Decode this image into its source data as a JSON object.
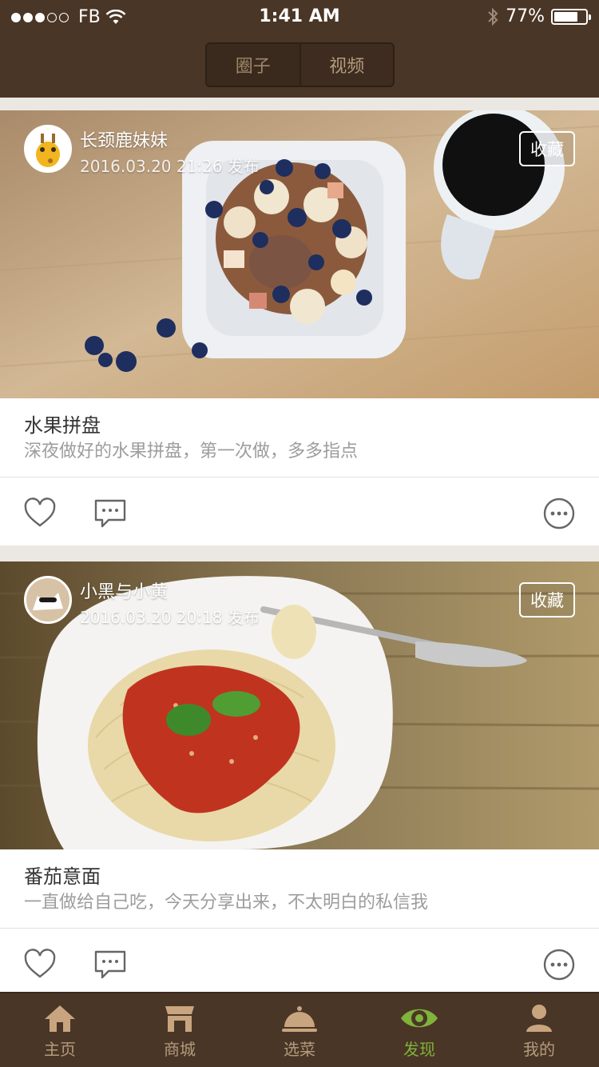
{
  "status_bar": {
    "carrier": "FB",
    "time": "1:41 AM",
    "battery_text": "77%",
    "battery_level": 0.77,
    "signal_bars_filled": 3,
    "signal_bars_total": 5
  },
  "segmented": {
    "tabs": [
      {
        "label": "圈子",
        "active": true
      },
      {
        "label": "视频",
        "active": false
      }
    ]
  },
  "posts": [
    {
      "author": "长颈鹿妹妹",
      "time": "2016.03.20 21:26 发布",
      "collect_label": "收藏",
      "title": "水果拼盘",
      "description": "深夜做好的水果拼盘，第一次做，多多指点"
    },
    {
      "author": "小黑与小黄",
      "time": "2016.03.20 20:18 发布",
      "collect_label": "收藏",
      "title": "番茄意面",
      "description": "一直做给自己吃，今天分享出来，不太明白的私信我"
    }
  ],
  "tabbar": {
    "items": [
      {
        "label": "主页",
        "icon": "home-icon",
        "active": false
      },
      {
        "label": "商城",
        "icon": "shop-icon",
        "active": false
      },
      {
        "label": "选菜",
        "icon": "cloche-icon",
        "active": false
      },
      {
        "label": "发现",
        "icon": "eye-icon",
        "active": true
      },
      {
        "label": "我的",
        "icon": "user-icon",
        "active": false
      }
    ]
  },
  "colors": {
    "header_bg": "#4a3626",
    "active_tab": "#7fb33a",
    "inactive_tab": "#b39b7e"
  }
}
